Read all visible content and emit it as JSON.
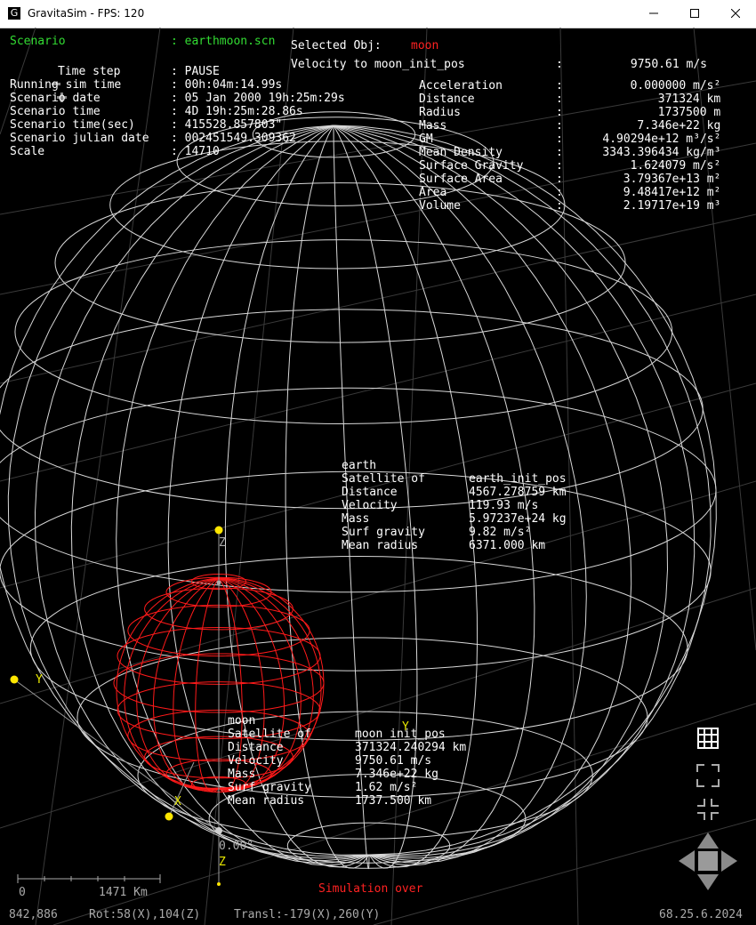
{
  "window": {
    "title": "GravitaSim - FPS: 120",
    "app_icon": "G",
    "minimize_icon": "minimize-icon",
    "maximize_icon": "maximize-icon",
    "close_icon": "close-icon"
  },
  "hud": {
    "scenario_label": "Scenario",
    "scenario_value": ": earthmoon.scn",
    "timestep_label": "Time step",
    "timestep_value": ": PAUSE",
    "rows": [
      {
        "label": "Running sim time",
        "value": ": 00h:04m:14.99s"
      },
      {
        "label": "Scenario date",
        "value": ": 05 Jan 2000 19h:25m:29s"
      },
      {
        "label": "Scenario time",
        "value": ": 4D 19h:25m:28.86s"
      },
      {
        "label": "Scenario time(sec)",
        "value": ": 415528.857803\""
      },
      {
        "label": "Scenario julian date",
        "value": ": 002451549.309362"
      },
      {
        "label": "Scale",
        "value": ": 14710"
      }
    ]
  },
  "selected": {
    "label": "Selected Obj:",
    "name": "moon",
    "velocity_label": "Velocity to moon_init_pos",
    "velocity_value": "9750.61 m/s",
    "props": [
      {
        "label": "Acceleration",
        "value": "0.000000 m/s²"
      },
      {
        "label": "Distance",
        "value": "371324 km"
      },
      {
        "label": "Radius",
        "value": "1737500 m"
      },
      {
        "label": "Mass",
        "value": "7.346e+22 kg"
      },
      {
        "label": "GM",
        "value": "4.90294e+12 m³/s²"
      },
      {
        "label": "Mean Density",
        "value": "3343.396434 kg/m³"
      },
      {
        "label": "Surface Gravity",
        "value": "1.624079 m/s²"
      },
      {
        "label": "Surface Area",
        "value": "3.79367e+13 m²"
      },
      {
        "label": "Area",
        "value": "9.48417e+12 m²"
      },
      {
        "label": "Volume",
        "value": "2.19717e+19 m³"
      }
    ]
  },
  "earth": {
    "name": "earth",
    "rows": [
      {
        "label": "Satellite of",
        "value": "earth_init_pos"
      },
      {
        "label": "Distance",
        "value": "4567.278759 km"
      },
      {
        "label": "Velocity",
        "value": "119.93 m/s"
      },
      {
        "label": "Mass",
        "value": "5.97237e+24 kg"
      },
      {
        "label": "Surf gravity",
        "value": "9.82 m/s²"
      },
      {
        "label": "Mean radius",
        "value": "6371.000 km"
      }
    ]
  },
  "moon": {
    "name": "moon",
    "rows": [
      {
        "label": "Satellite of",
        "value": "moon_init_pos"
      },
      {
        "label": "Distance",
        "value": "371324.240294 km"
      },
      {
        "label": "Velocity",
        "value": "9750.61 m/s"
      },
      {
        "label": "Mass",
        "value": "7.346e+22 kg"
      },
      {
        "label": "Surf gravity",
        "value": "1.62 m/s²"
      },
      {
        "label": "Mean radius",
        "value": "1737.500 km"
      }
    ]
  },
  "axes": {
    "z": "Z",
    "y": "Y",
    "x": "X",
    "angle": "0.00°"
  },
  "scale_bar": {
    "start": "0",
    "end": "1471 Km"
  },
  "status": {
    "message": "Simulation over",
    "cursor": "842,886",
    "rotation": "Rot:58(X),104(Z)",
    "translation": "Transl:-179(X),260(Y)",
    "version": "68.25.6.2024"
  },
  "controls": {
    "zoom_icons": [
      "minus-icon",
      "plus-icon"
    ],
    "grid_icon": "grid-icon",
    "fit_icon": "fit-view-icon",
    "shrink_icon": "shrink-view-icon",
    "pan_icon": "pan-arrows-icon"
  },
  "colors": {
    "earth_wire": "#d8d8d8",
    "moon_wire": "#ff1a1a",
    "hud_green": "#33dd33",
    "highlight_red": "#ff2222",
    "axis_yellow": "#e8e800"
  }
}
